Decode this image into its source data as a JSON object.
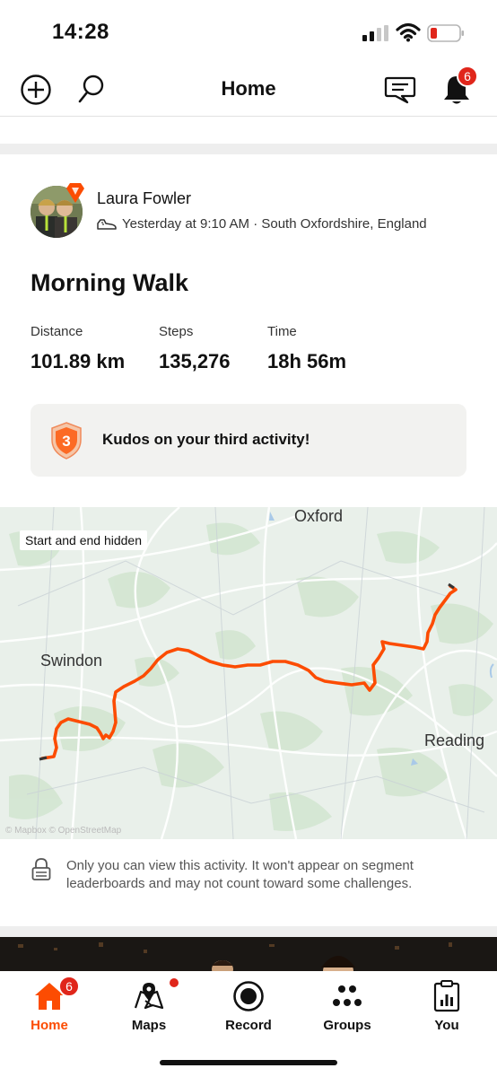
{
  "status_bar": {
    "time": "14:28",
    "signal_icon": "cellular-signal-icon",
    "wifi_icon": "wifi-icon",
    "battery_icon": "battery-low-icon"
  },
  "header": {
    "title": "Home",
    "add_icon": "plus-circle-icon",
    "search_icon": "search-icon",
    "messages_icon": "chat-bubble-icon",
    "notifications_icon": "bell-icon",
    "notifications_count": "6"
  },
  "activity": {
    "athlete_name": "Laura Fowler",
    "meta": "Yesterday at 9:10 AM · South Oxfordshire, England",
    "shoe_icon": "shoe-icon",
    "title": "Morning Walk",
    "stats": [
      {
        "label": "Distance",
        "value": "101.89 km"
      },
      {
        "label": "Steps",
        "value": "135,276"
      },
      {
        "label": "Time",
        "value": "18h 56m"
      }
    ],
    "kudos_badge_number": "3",
    "kudos_text": "Kudos on your third activity!",
    "map": {
      "hidden_label": "Start and end hidden",
      "places": [
        "Oxford",
        "Swindon",
        "Reading"
      ],
      "attribution": "© Mapbox © OpenStreetMap"
    },
    "privacy_text": "Only you can view this activity. It won't appear on segment leaderboards and may not count toward some challenges."
  },
  "colors": {
    "accent": "#fc4c02",
    "badge": "#e0261b",
    "route": "#fc4c02"
  },
  "tabs": [
    {
      "label": "Home",
      "icon": "home-icon",
      "badge": "6",
      "active": true
    },
    {
      "label": "Maps",
      "icon": "map-icon",
      "dot": true
    },
    {
      "label": "Record",
      "icon": "record-icon"
    },
    {
      "label": "Groups",
      "icon": "groups-icon"
    },
    {
      "label": "You",
      "icon": "profile-icon"
    }
  ]
}
